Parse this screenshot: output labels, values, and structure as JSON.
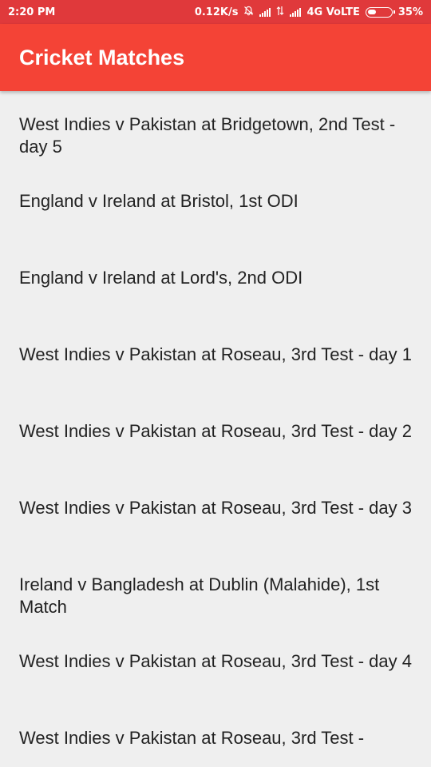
{
  "status_bar": {
    "time": "2:20 PM",
    "speed": "0.12K/s",
    "network": "4G VoLTE",
    "battery": "35%"
  },
  "app_bar": {
    "title": "Cricket Matches"
  },
  "matches": [
    "West Indies v Pakistan at Bridgetown, 2nd Test - day 5",
    "England v Ireland at Bristol, 1st ODI",
    "England v Ireland at Lord's, 2nd ODI",
    "West Indies v Pakistan at Roseau, 3rd Test - day 1",
    "West Indies v Pakistan at Roseau, 3rd Test - day 2",
    "West Indies v Pakistan at Roseau, 3rd Test - day 3",
    "Ireland v Bangladesh at Dublin (Malahide), 1st Match",
    "West Indies v Pakistan at Roseau, 3rd Test - day 4",
    "West Indies v Pakistan at Roseau, 3rd Test -"
  ],
  "colors": {
    "status_bar": "#e0393b",
    "app_bar": "#f44336",
    "background": "#efefef"
  },
  "icons": [
    "bell-off-icon",
    "signal-icon",
    "data-arrows-icon",
    "signal-icon",
    "battery-icon"
  ]
}
